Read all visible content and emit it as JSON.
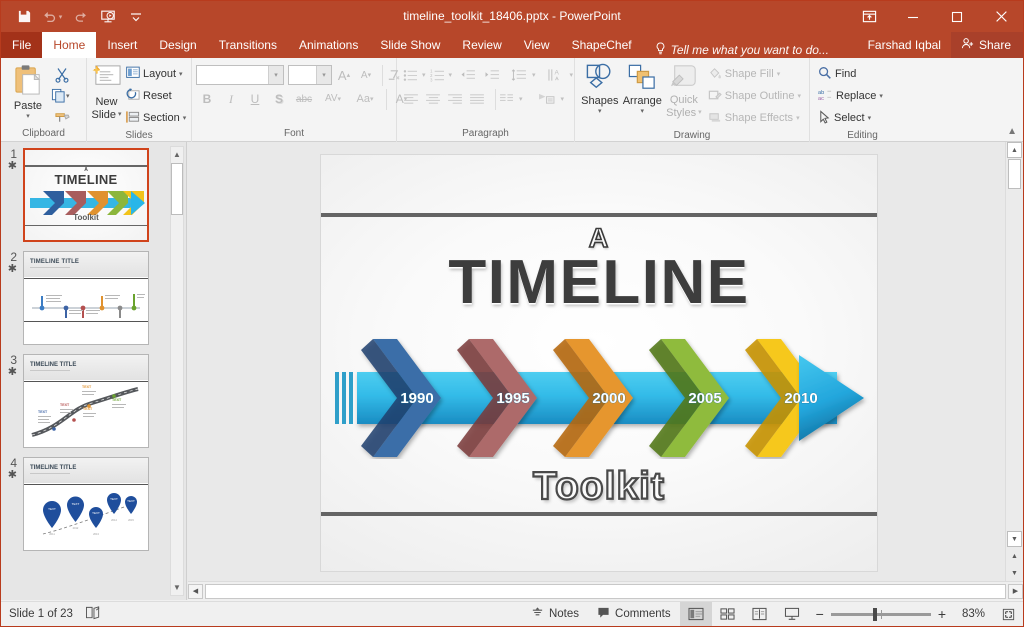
{
  "window": {
    "title": "timeline_toolkit_18406.pptx - PowerPoint",
    "minimize_label": "–",
    "maximize_label": "□",
    "close_label": "✕",
    "ribbon_display_label": "ribbon-display-options"
  },
  "quick_access": [
    {
      "name": "save-icon",
      "label": "Save"
    },
    {
      "name": "undo-icon",
      "label": "Undo"
    },
    {
      "name": "redo-icon",
      "label": "Redo"
    },
    {
      "name": "start-presentation-icon",
      "label": "Start From Beginning"
    },
    {
      "name": "customize-qat-icon",
      "label": "Customize Quick Access Toolbar"
    }
  ],
  "tabs": [
    {
      "label": "File",
      "active": false
    },
    {
      "label": "Home",
      "active": true
    },
    {
      "label": "Insert",
      "active": false
    },
    {
      "label": "Design",
      "active": false
    },
    {
      "label": "Transitions",
      "active": false
    },
    {
      "label": "Animations",
      "active": false
    },
    {
      "label": "Slide Show",
      "active": false
    },
    {
      "label": "Review",
      "active": false
    },
    {
      "label": "View",
      "active": false
    },
    {
      "label": "ShapeChef",
      "active": false
    }
  ],
  "tell_me": "Tell me what you want to do...",
  "account": {
    "user": "Farshad Iqbal",
    "share_label": "Share"
  },
  "ribbon": {
    "clipboard": {
      "group_label": "Clipboard",
      "paste_label": "Paste",
      "cut_label": "Cut",
      "copy_label": "Copy",
      "format_painter_label": "Format Painter"
    },
    "slides": {
      "group_label": "Slides",
      "new_slide_label": "New\nSlide",
      "new_slide_line1": "New",
      "new_slide_line2": "Slide",
      "layout_label": "Layout",
      "reset_label": "Reset",
      "section_label": "Section"
    },
    "font": {
      "group_label": "Font",
      "font_name_value": "",
      "font_size_value": "",
      "grow_font_label": "A",
      "shrink_font_label": "A",
      "clear_formatting_label": "Clear All Formatting",
      "bold_label": "B",
      "italic_label": "I",
      "underline_label": "U",
      "shadow_label": "S",
      "strikethrough_label": "abc",
      "character_spacing_label": "AV",
      "change_case_label": "Aa",
      "font_color_label": "A"
    },
    "paragraph": {
      "group_label": "Paragraph"
    },
    "drawing": {
      "group_label": "Drawing",
      "shapes_label": "Shapes",
      "arrange_label": "Arrange",
      "quick_styles_line1": "Quick",
      "quick_styles_line2": "Styles",
      "shape_fill_label": "Shape Fill",
      "shape_outline_label": "Shape Outline",
      "shape_effects_label": "Shape Effects"
    },
    "editing": {
      "group_label": "Editing",
      "find_label": "Find",
      "replace_label": "Replace",
      "select_label": "Select"
    },
    "collapse_label": "Collapse the Ribbon"
  },
  "thumbnails": [
    {
      "number": "1",
      "selected": true,
      "kind": "title",
      "title": ""
    },
    {
      "number": "2",
      "selected": false,
      "kind": "timeline",
      "title": "TIMELINE TITLE"
    },
    {
      "number": "3",
      "selected": false,
      "kind": "road",
      "title": "TIMELINE TITLE"
    },
    {
      "number": "4",
      "selected": false,
      "kind": "pins",
      "title": "TIMELINE TITLE"
    }
  ],
  "slide": {
    "title_small": "A",
    "title_main": "TIMELINE",
    "subtitle": "Toolkit",
    "timeline": {
      "segments": [
        {
          "year": "1990",
          "color": "#2f5f9e",
          "color_dark": "#1d3f6e"
        },
        {
          "year": "1995",
          "color": "#a85d5d",
          "color_dark": "#7a3a3a"
        },
        {
          "year": "2000",
          "color": "#e0922f",
          "color_dark": "#b06a12"
        },
        {
          "year": "2005",
          "color": "#8cb63c",
          "color_dark": "#5b7d1c"
        },
        {
          "year": "2010",
          "color": "#f2c31a",
          "color_dark": "#c59400"
        }
      ],
      "band_color_light": "#3fc3ec",
      "band_color_dark": "#1a90c5",
      "arrow_head_color": "#29b6e8"
    }
  },
  "status": {
    "slide_counter": "Slide 1 of 23",
    "accessibility_label": "accessibility-checker",
    "notes_label": "Notes",
    "comments_label": "Comments",
    "views": [
      {
        "name": "normal-view-button",
        "active": true
      },
      {
        "name": "slide-sorter-button",
        "active": false
      },
      {
        "name": "reading-view-button",
        "active": false
      },
      {
        "name": "slideshow-button",
        "active": false
      }
    ],
    "zoom_out_label": "−",
    "zoom_in_label": "+",
    "zoom_percent": "83%",
    "fit_label": "fit-slide-to-window"
  }
}
